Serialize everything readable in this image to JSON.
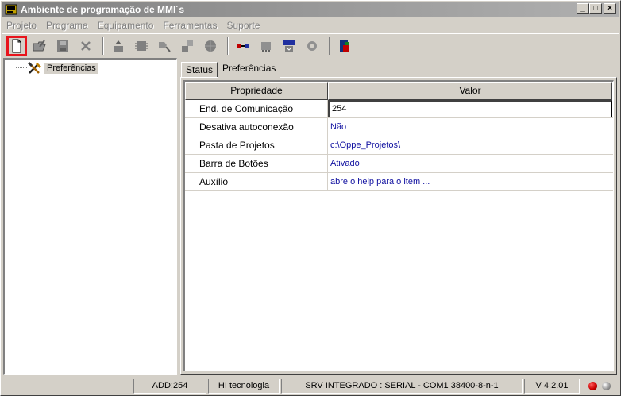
{
  "window": {
    "title": "Ambiente de programação de MMI´s",
    "minimize_label": "_",
    "maximize_label": "□",
    "close_label": "×"
  },
  "menu": [
    "Projeto",
    "Programa",
    "Equipamento",
    "Ferramentas",
    "Suporte"
  ],
  "toolbar": {
    "icons": [
      "new-file-icon",
      "open-folder-icon",
      "save-disk-icon",
      "delete-x-icon",
      "upload-icon",
      "chip-icon",
      "download-icon",
      "transfer-icon",
      "globe-icon",
      "connect-icon",
      "network-icon",
      "serial-icon",
      "gear-icon",
      "exit-icon"
    ],
    "highlight_color": "#e8141c"
  },
  "tree": {
    "root_label": "Preferências"
  },
  "tabs": [
    {
      "label": "Status",
      "active": false
    },
    {
      "label": "Preferências",
      "active": true
    }
  ],
  "grid": {
    "columns": [
      "Propriedade",
      "Valor"
    ],
    "rows": [
      {
        "property": "End. de Comunicação",
        "value": "254"
      },
      {
        "property": "Desativa autoconexão",
        "value": "Não"
      },
      {
        "property": "Pasta de Projetos",
        "value": "c:\\Oppe_Projetos\\"
      },
      {
        "property": "Barra de Botões",
        "value": "Ativado"
      },
      {
        "property": "Auxílio",
        "value": "abre o help para o item ..."
      }
    ],
    "value_color": "#1010a0"
  },
  "statusbar": {
    "address": "ADD:254",
    "company": "HI tecnologia",
    "connection": "SRV INTEGRADO : SERIAL - COM1 38400-8-n-1",
    "version": "V 4.2.01",
    "led_colors": [
      "#cc0000",
      "#9a9a9a"
    ]
  }
}
